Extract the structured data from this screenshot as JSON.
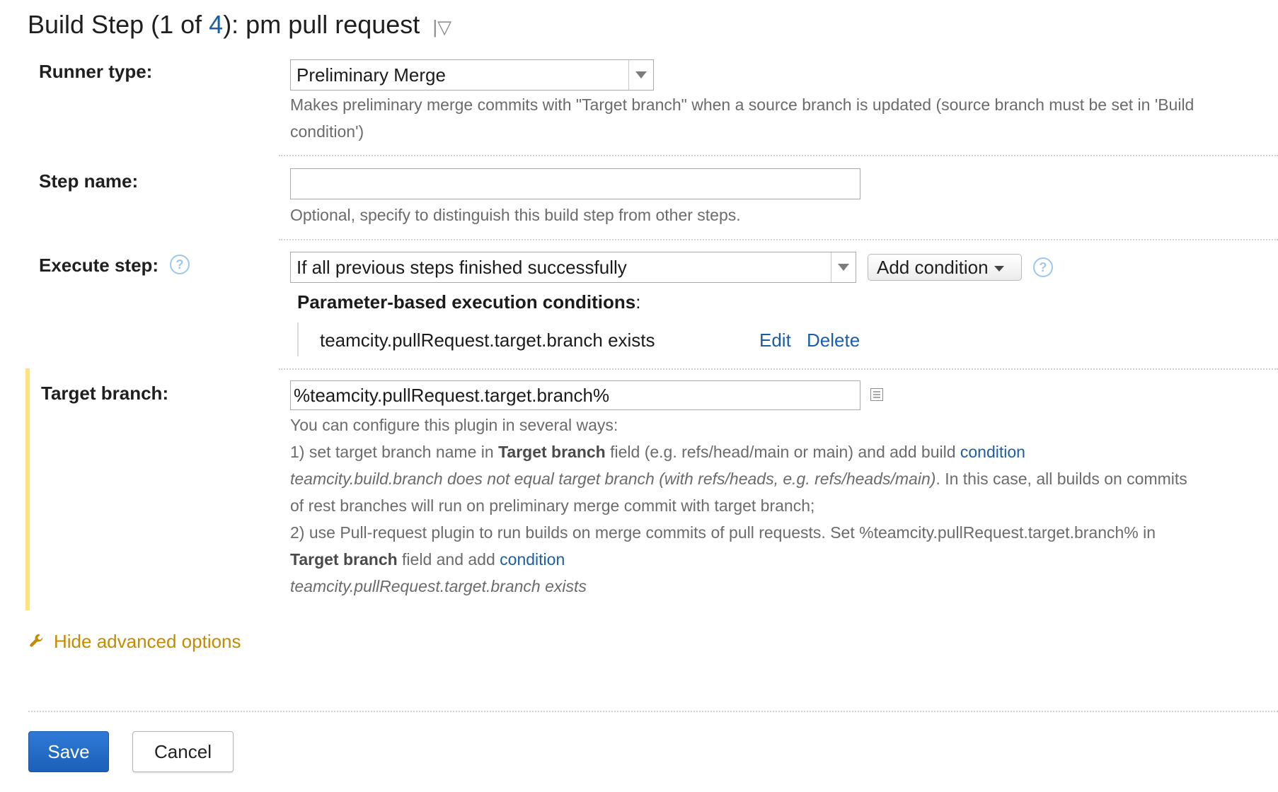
{
  "header": {
    "title_prefix": "Build Step (1 of ",
    "title_link": "4",
    "title_suffix": "): pm pull request",
    "menu_symbol": "|▽"
  },
  "runner": {
    "label": "Runner type:",
    "value": "Preliminary Merge",
    "description": "Makes preliminary merge commits with \"Target branch\" when a source branch is updated (source branch must be set in 'Build condition')"
  },
  "step_name": {
    "label": "Step name:",
    "value": "",
    "hint": "Optional, specify to distinguish this build step from other steps."
  },
  "execute": {
    "label": "Execute step:",
    "value": "If all previous steps finished successfully",
    "add_condition": "Add condition",
    "help": "?",
    "param_heading": "Parameter-based execution conditions",
    "param_colon": ":",
    "condition_text": "teamcity.pullRequest.target.branch exists",
    "edit": "Edit",
    "delete": "Delete"
  },
  "target": {
    "label": "Target branch:",
    "value": "%teamcity.pullRequest.target.branch%",
    "help": {
      "intro": "You can configure this plugin in several ways:",
      "p1_a": "1) set target branch name in ",
      "p1_b": "Target branch",
      "p1_c": " field (e.g. refs/head/main or main) and add build ",
      "p1_link": "condition",
      "p1_italic": "teamcity.build.branch does not equal target branch (with refs/heads, e.g. refs/heads/main)",
      "p1_d": ". In this case, all builds on commits of rest branches will run on preliminary merge commit with target branch;",
      "p2_a": "2) use Pull-request plugin to run builds on merge commits of pull requests. Set %teamcity.pullRequest.target.branch% in ",
      "p2_b": "Target branch",
      "p2_c": " field and add ",
      "p2_link": "condition",
      "p2_italic": "teamcity.pullRequest.target.branch exists"
    }
  },
  "advanced": {
    "label": "Hide advanced options"
  },
  "buttons": {
    "save": "Save",
    "cancel": "Cancel"
  },
  "colors": {
    "accent": "#1b5ea8",
    "advanced": "#c48a00",
    "highlight_bar": "#ffe27a"
  }
}
